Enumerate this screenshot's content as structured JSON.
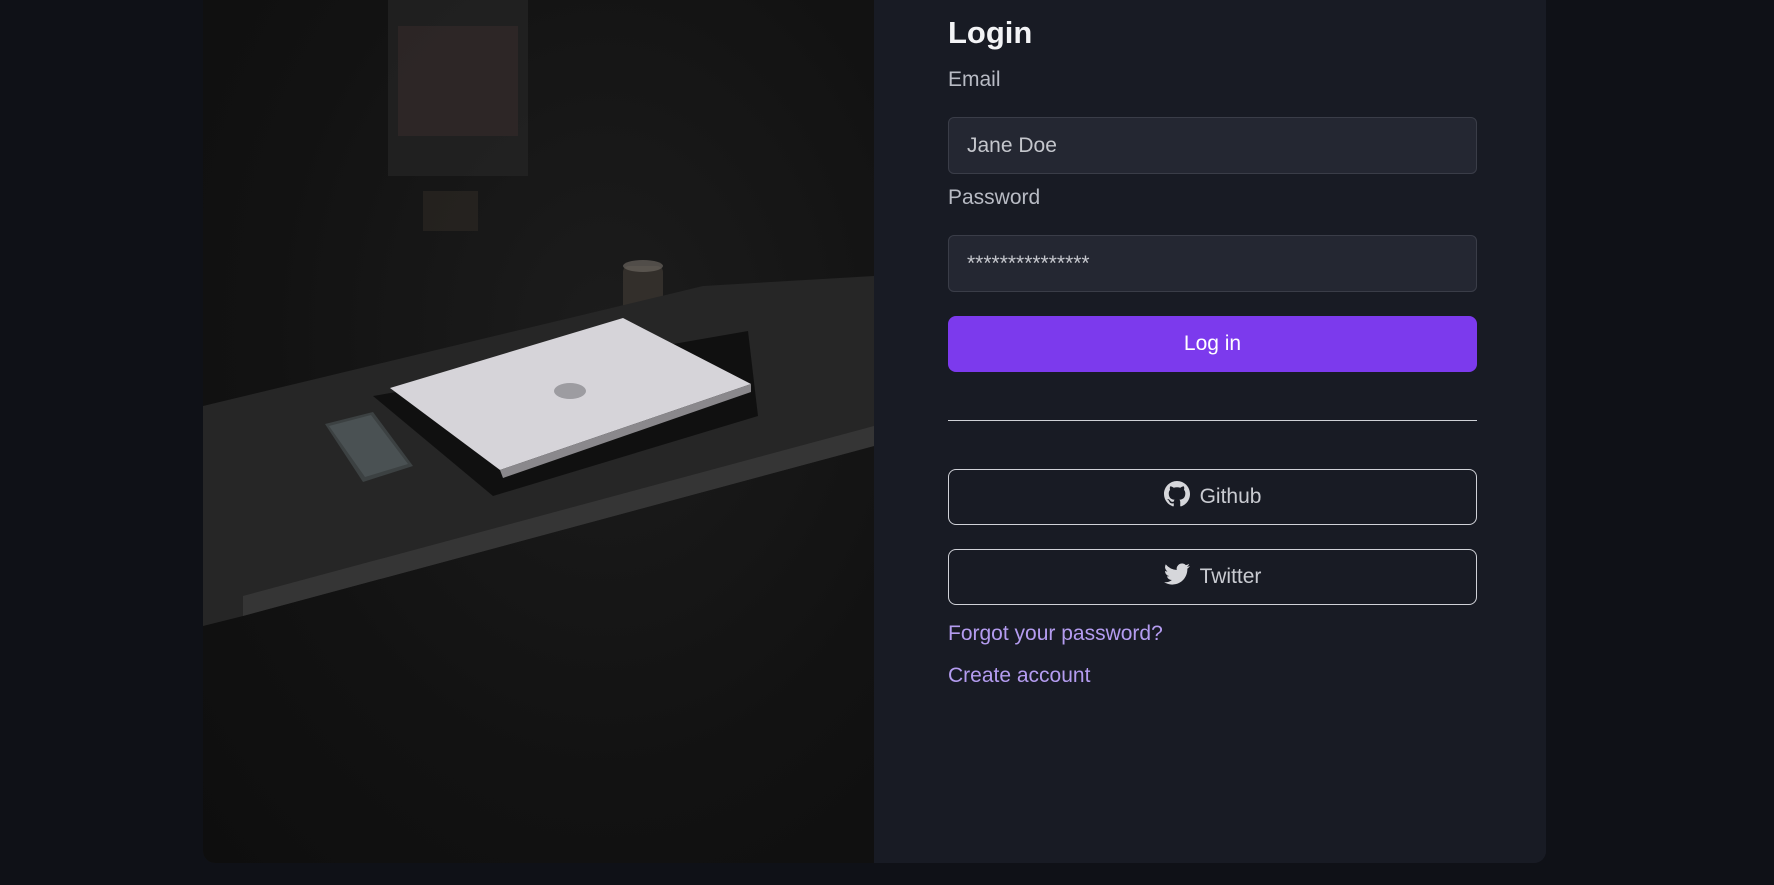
{
  "login": {
    "title": "Login",
    "email_label": "Email",
    "email_value": "Jane Doe",
    "password_label": "Password",
    "password_value": "***************",
    "login_button": "Log in",
    "github_button": "Github",
    "twitter_button": "Twitter",
    "forgot_link": "Forgot your password?",
    "create_link": "Create account"
  },
  "icons": {
    "github": "github-icon",
    "twitter": "twitter-icon"
  },
  "colors": {
    "accent": "#7c3aed",
    "link": "#b49cf0",
    "background": "#0f1117",
    "panel": "#181b24"
  }
}
